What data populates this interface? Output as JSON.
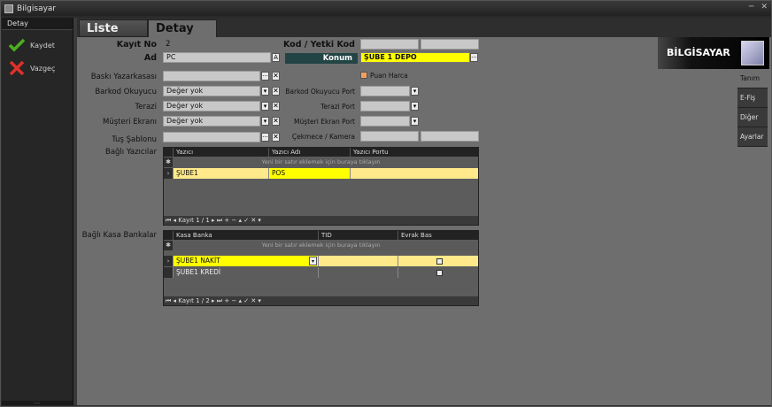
{
  "window": {
    "title": "Bilgisayar"
  },
  "sidebar": {
    "header": "Detay",
    "items": [
      {
        "label": "Kaydet",
        "icon": "check-icon"
      },
      {
        "label": "Vazgeç",
        "icon": "cross-icon"
      }
    ]
  },
  "tabs": {
    "list": "Liste",
    "detail": "Detay"
  },
  "banner": {
    "title": "BİLGİSAYAR"
  },
  "vertical_tabs": [
    "Tanım",
    "E-Fiş",
    "Diğer",
    "Ayarlar"
  ],
  "form": {
    "kayit_no_label": "Kayıt No",
    "kayit_no_value": "2",
    "ad_label": "Ad",
    "ad_value": "PC",
    "kod_label": "Kod / Yetki Kod",
    "kod_value": "",
    "yetki_value": "",
    "konum_label": "Konum",
    "konum_value": "ŞUBE 1 DEPO",
    "baski_label": "Baskı Yazarkasası",
    "baski_value": "",
    "barkod_label": "Barkod Okuyucu",
    "barkod_value": "Değer yok",
    "terazi_label": "Terazi",
    "terazi_value": "Değer yok",
    "musteri_label": "Müşteri Ekranı",
    "musteri_value": "Değer yok",
    "tus_label": "Tuş Şablonu",
    "tus_value": "",
    "bagli_yazicilar_label": "Bağlı Yazıcılar",
    "bagli_kasa_label": "Bağlı Kasa Bankalar",
    "puan_harca_label": "Puan Harca",
    "barkod_port_label": "Barkod Okuyucu Port",
    "terazi_port_label": "Terazi Port",
    "musteri_port_label": "Müşteri Ekran Port",
    "cekmece_label": "Çekmece / Kamera"
  },
  "printers_grid": {
    "columns": [
      "Yazıcı",
      "Yazıcı Adı",
      "Yazıcı Portu"
    ],
    "new_row_hint": "Yeni bir satır eklemek için buraya tıklayın",
    "rows": [
      {
        "yazici": "ŞUBE1",
        "adi": "POS",
        "portu": ""
      }
    ],
    "nav_text": "Kayıt 1 / 1"
  },
  "kasa_grid": {
    "columns": [
      "Kasa Banka",
      "TID",
      "Evrak Bas"
    ],
    "new_row_hint": "Yeni bir satır eklemek için buraya tıklayın",
    "rows": [
      {
        "kasa": "ŞUBE1 NAKİT",
        "tid": ""
      },
      {
        "kasa": "ŞUBE1 KREDİ",
        "tid": ""
      }
    ],
    "nav_text": "Kayıt 1 / 2"
  },
  "colors": {
    "highlight_yellow": "#ffff00",
    "selected_row": "#ffe98a",
    "panel_gray": "#6e6e6e"
  }
}
